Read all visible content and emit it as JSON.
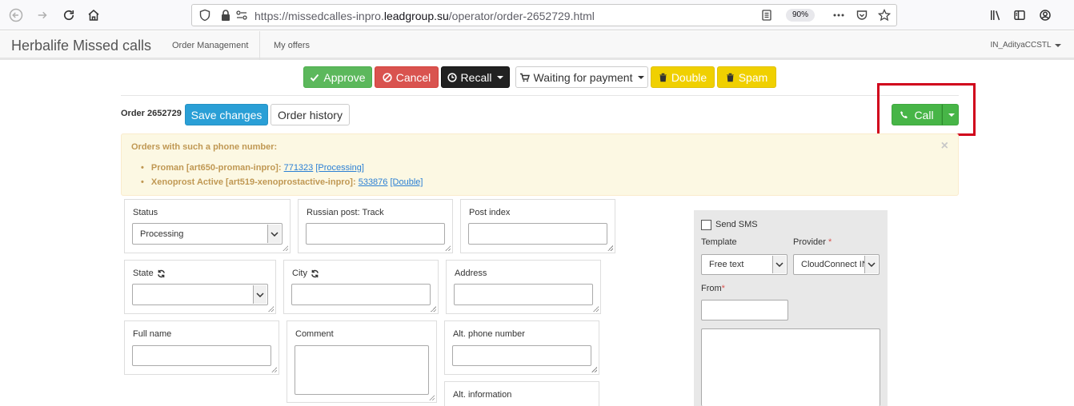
{
  "browser": {
    "url_scheme": "https://missedcalles-inpro.",
    "url_domain": "leadgroup.su",
    "url_path": "/operator/order-2652729.html",
    "zoom": "90%"
  },
  "header": {
    "brand": "Herbalife Missed calls",
    "nav": [
      "Order Management",
      "My offers"
    ],
    "user": "IN_AdityaCCSTL"
  },
  "actions": {
    "approve": "Approve",
    "cancel": "Cancel",
    "recall": "Recall",
    "waiting": "Waiting for payment",
    "double": "Double",
    "spam": "Spam"
  },
  "order": {
    "label": "Order 2652729",
    "save": "Save changes",
    "history": "Order history",
    "call": "Call"
  },
  "alert": {
    "title": "Orders with such a phone number:",
    "items": [
      {
        "name": "Proman [art650-proman-inpro]",
        "id": "771323",
        "status": "[Processing]"
      },
      {
        "name": "Xenoprost Active [art519-xenoprostactive-inpro]",
        "id": "533876",
        "status": "[Double]"
      }
    ]
  },
  "form": {
    "status_label": "Status",
    "status_value": "Processing",
    "track_label": "Russian post: Track",
    "postindex_label": "Post index",
    "state_label": "State",
    "city_label": "City",
    "address_label": "Address",
    "fullname_label": "Full name",
    "comment_label": "Comment",
    "altphone_label": "Alt. phone number",
    "altinfo_label": "Alt. information"
  },
  "sms": {
    "send_label": "Send SMS",
    "template_label": "Template",
    "template_value": "Free text",
    "provider_label": "Provider",
    "provider_value": "CloudConnect IN",
    "from_label": "From",
    "required_mark": "*"
  },
  "colors": {
    "approve": "#5cb85c",
    "cancel": "#d9534f",
    "recall": "#222222",
    "yellow": "#f0d000",
    "blue": "#2a9fd6",
    "call": "#47b547",
    "highlight": "#d0021b"
  }
}
